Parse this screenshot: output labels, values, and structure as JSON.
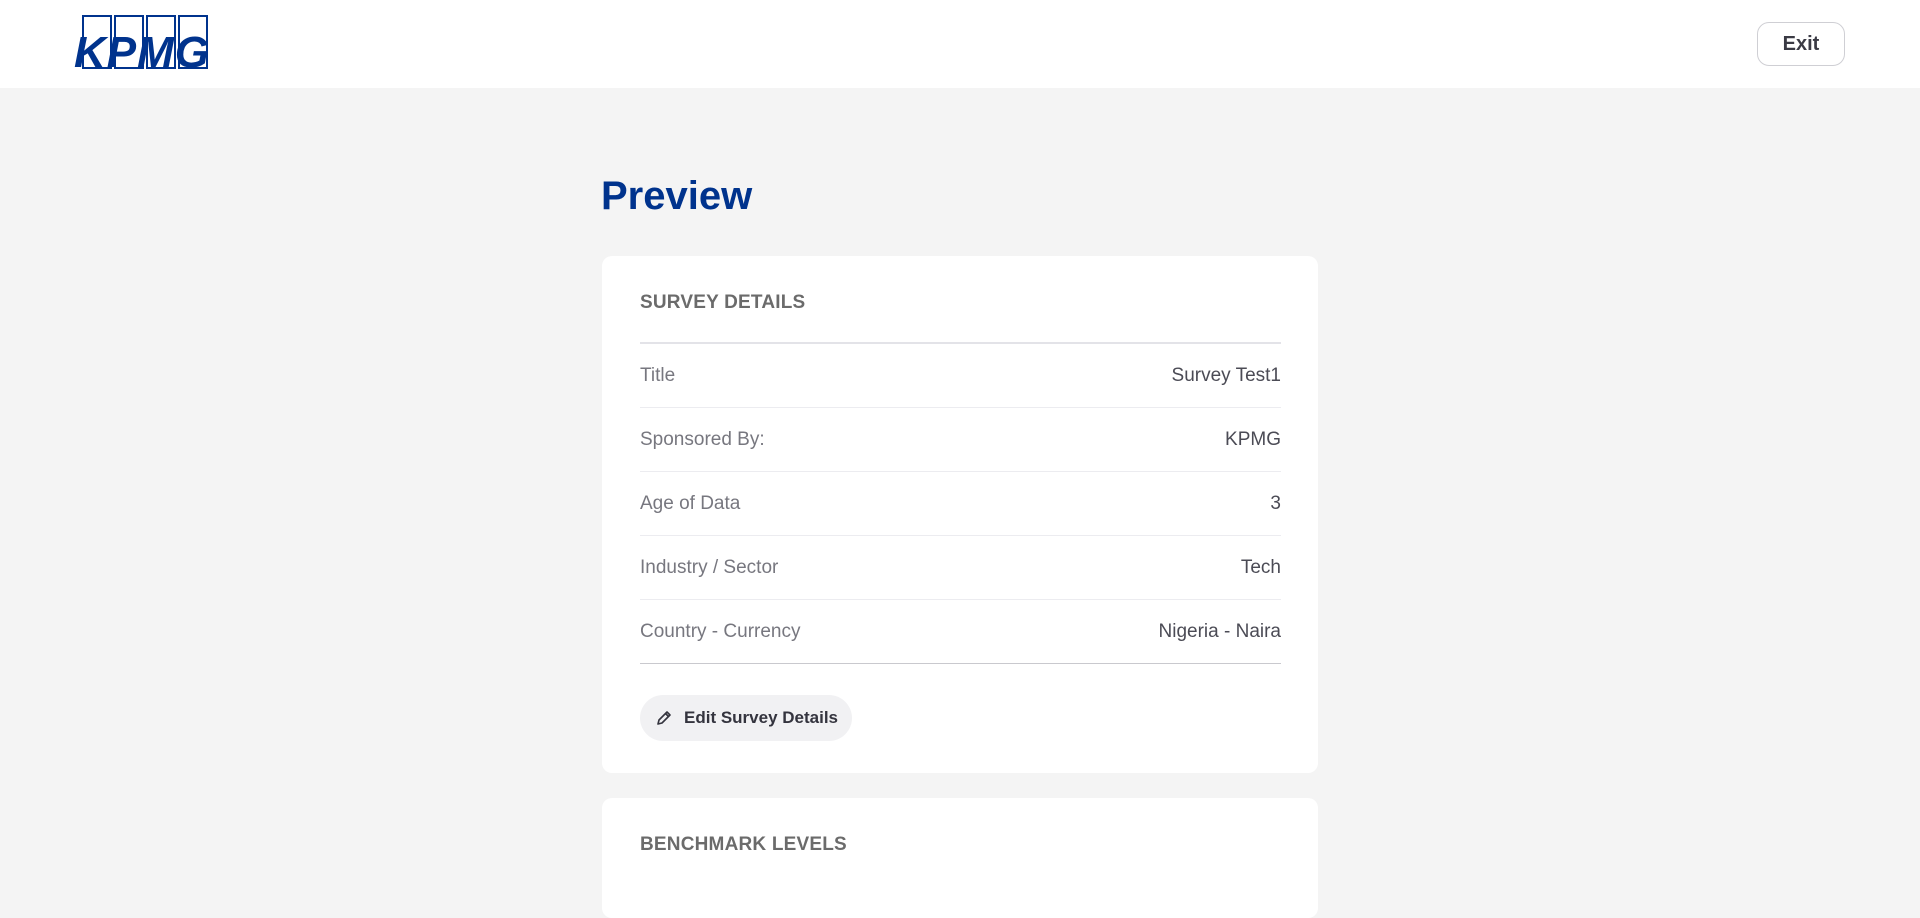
{
  "header": {
    "logo_text": "KPMG",
    "exit_label": "Exit"
  },
  "page": {
    "title": "Preview"
  },
  "survey_details": {
    "heading": "SURVEY DETAILS",
    "rows": [
      {
        "label": "Title",
        "value": "Survey Test1"
      },
      {
        "label": "Sponsored By:",
        "value": "KPMG"
      },
      {
        "label": "Age of Data",
        "value": "3"
      },
      {
        "label": "Industry / Sector",
        "value": "Tech"
      },
      {
        "label": "Country - Currency",
        "value": "Nigeria - Naira"
      }
    ],
    "edit_label": "Edit Survey Details",
    "edit_icon": "pencil-icon"
  },
  "benchmark_levels": {
    "heading": "BENCHMARK LEVELS"
  },
  "colors": {
    "brand": "#00338d",
    "background": "#f4f4f4",
    "card": "#ffffff"
  }
}
